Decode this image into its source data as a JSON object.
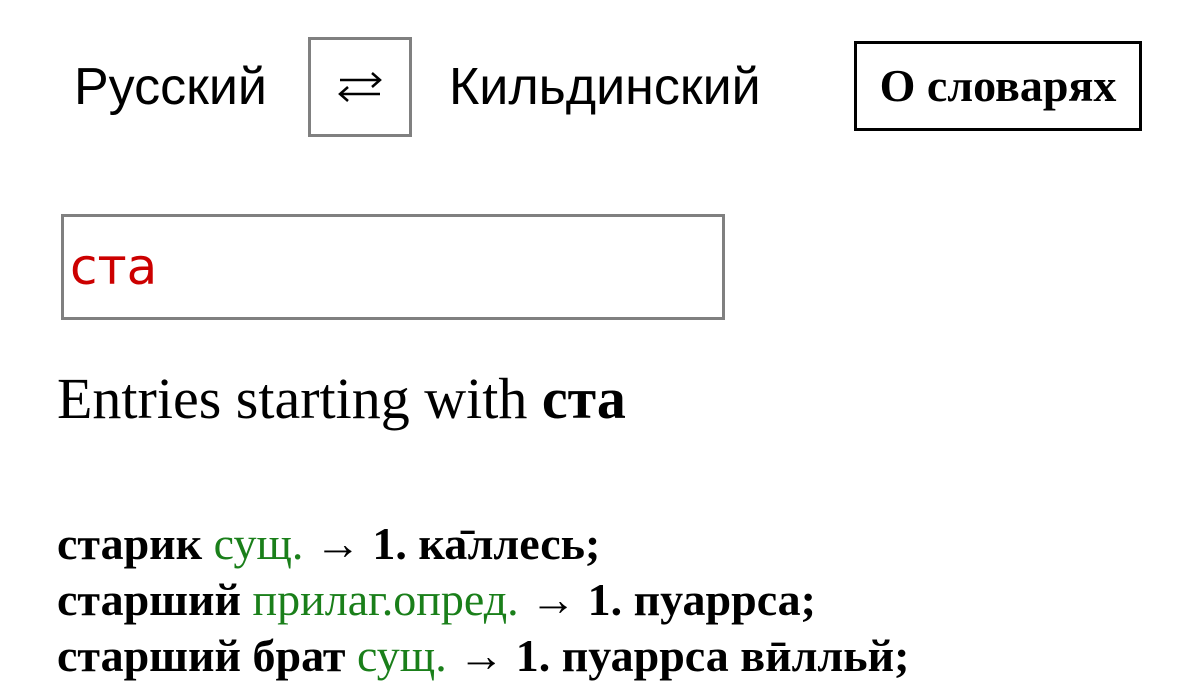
{
  "header": {
    "source_language": "Русский",
    "target_language": "Кильдинский",
    "swap_symbol": "⇄",
    "about_label": "О словарях"
  },
  "search": {
    "value": "ста",
    "color": "#cc0000"
  },
  "results": {
    "heading_prefix": "Entries starting with",
    "heading_term": "ста",
    "entries": [
      {
        "headword": "старик",
        "pos": "сущ.",
        "arrow": "→",
        "translation": "1. ка̄ллесь;"
      },
      {
        "headword": "старший",
        "pos": "прилаг.опред.",
        "arrow": "→",
        "translation": "1. пуаррса;"
      },
      {
        "headword": "старший брат",
        "pos": "сущ.",
        "arrow": "→",
        "translation": "1. пуаррса вӣлльй;"
      }
    ]
  },
  "colors": {
    "part_of_speech": "#1a7f1a",
    "input_border": "#808080",
    "search_text": "#cc0000"
  }
}
